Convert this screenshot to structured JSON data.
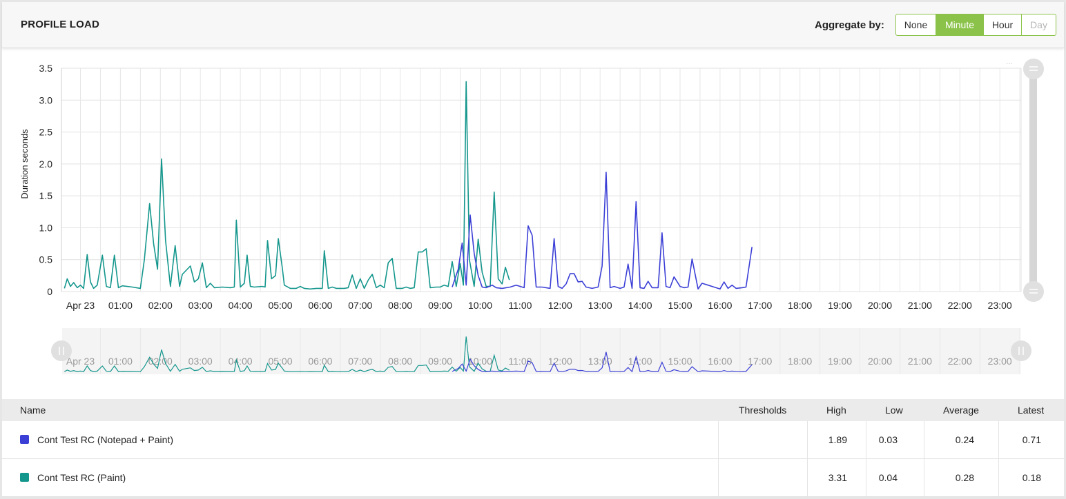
{
  "header": {
    "title": "PROFILE LOAD",
    "aggregate_label": "Aggregate by:",
    "aggregate_options": [
      "None",
      "Minute",
      "Hour",
      "Day"
    ],
    "aggregate_selected": "Minute"
  },
  "colors": {
    "blue": "#3b3fd6",
    "teal": "#13968c",
    "accent": "#8bc34a"
  },
  "chart_data": {
    "type": "line",
    "ylabel": "Duration seconds",
    "ylim": [
      0,
      3.5
    ],
    "y_ticks": [
      "0",
      "0.5",
      "1.0",
      "1.5",
      "2.0",
      "2.5",
      "3.0",
      "3.5"
    ],
    "x_ticks": [
      "Apr 23",
      "01:00",
      "02:00",
      "03:00",
      "04:00",
      "05:00",
      "06:00",
      "07:00",
      "08:00",
      "09:00",
      "10:00",
      "11:00",
      "12:00",
      "13:00",
      "14:00",
      "15:00",
      "16:00",
      "17:00",
      "18:00",
      "19:00",
      "20:00",
      "21:00",
      "22:00",
      "23:00"
    ],
    "x_unit": "hours",
    "xlim": [
      0,
      23.9
    ],
    "grid": true,
    "series": [
      {
        "name": "Cont Test RC (Paint)",
        "color": "#13968c",
        "points": [
          [
            -0.4,
            0.05
          ],
          [
            -0.33,
            0.2
          ],
          [
            -0.25,
            0.08
          ],
          [
            -0.17,
            0.14
          ],
          [
            -0.08,
            0.06
          ],
          [
            0.0,
            0.1
          ],
          [
            0.08,
            0.05
          ],
          [
            0.17,
            0.58
          ],
          [
            0.25,
            0.15
          ],
          [
            0.33,
            0.05
          ],
          [
            0.42,
            0.1
          ],
          [
            0.55,
            0.57
          ],
          [
            0.65,
            0.08
          ],
          [
            0.75,
            0.06
          ],
          [
            0.85,
            0.57
          ],
          [
            0.95,
            0.06
          ],
          [
            1.05,
            0.09
          ],
          [
            1.3,
            0.07
          ],
          [
            1.5,
            0.05
          ],
          [
            1.6,
            0.5
          ],
          [
            1.73,
            1.38
          ],
          [
            1.83,
            0.75
          ],
          [
            1.93,
            0.35
          ],
          [
            2.03,
            2.08
          ],
          [
            2.13,
            0.8
          ],
          [
            2.25,
            0.08
          ],
          [
            2.37,
            0.72
          ],
          [
            2.48,
            0.08
          ],
          [
            2.55,
            0.27
          ],
          [
            2.75,
            0.4
          ],
          [
            2.85,
            0.15
          ],
          [
            2.95,
            0.2
          ],
          [
            3.05,
            0.45
          ],
          [
            3.15,
            0.06
          ],
          [
            3.25,
            0.13
          ],
          [
            3.35,
            0.06
          ],
          [
            3.55,
            0.07
          ],
          [
            3.75,
            0.06
          ],
          [
            3.85,
            0.07
          ],
          [
            3.9,
            1.12
          ],
          [
            4.0,
            0.07
          ],
          [
            4.1,
            0.13
          ],
          [
            4.17,
            0.57
          ],
          [
            4.25,
            0.08
          ],
          [
            4.35,
            0.07
          ],
          [
            4.55,
            0.08
          ],
          [
            4.62,
            0.07
          ],
          [
            4.68,
            0.8
          ],
          [
            4.78,
            0.2
          ],
          [
            4.88,
            0.25
          ],
          [
            4.95,
            0.83
          ],
          [
            5.05,
            0.37
          ],
          [
            5.1,
            0.1
          ],
          [
            5.25,
            0.05
          ],
          [
            5.4,
            0.05
          ],
          [
            5.5,
            0.08
          ],
          [
            5.6,
            0.05
          ],
          [
            5.75,
            0.04
          ],
          [
            5.9,
            0.05
          ],
          [
            6.05,
            0.05
          ],
          [
            6.1,
            0.64
          ],
          [
            6.2,
            0.05
          ],
          [
            6.3,
            0.07
          ],
          [
            6.4,
            0.05
          ],
          [
            6.6,
            0.05
          ],
          [
            6.7,
            0.06
          ],
          [
            6.8,
            0.26
          ],
          [
            6.9,
            0.05
          ],
          [
            7.0,
            0.2
          ],
          [
            7.1,
            0.05
          ],
          [
            7.2,
            0.18
          ],
          [
            7.3,
            0.27
          ],
          [
            7.4,
            0.06
          ],
          [
            7.5,
            0.1
          ],
          [
            7.6,
            0.06
          ],
          [
            7.7,
            0.45
          ],
          [
            7.8,
            0.52
          ],
          [
            7.9,
            0.05
          ],
          [
            8.05,
            0.05
          ],
          [
            8.15,
            0.07
          ],
          [
            8.25,
            0.05
          ],
          [
            8.35,
            0.06
          ],
          [
            8.45,
            0.62
          ],
          [
            8.55,
            0.62
          ],
          [
            8.65,
            0.67
          ],
          [
            8.75,
            0.06
          ],
          [
            8.9,
            0.07
          ],
          [
            9.0,
            0.07
          ],
          [
            9.1,
            0.1
          ],
          [
            9.2,
            0.08
          ],
          [
            9.3,
            0.47
          ],
          [
            9.4,
            0.08
          ],
          [
            9.5,
            0.44
          ],
          [
            9.58,
            0.1
          ],
          [
            9.65,
            3.29
          ],
          [
            9.73,
            0.5
          ],
          [
            9.85,
            0.08
          ],
          [
            9.95,
            0.82
          ],
          [
            10.05,
            0.3
          ],
          [
            10.15,
            0.08
          ],
          [
            10.25,
            0.08
          ],
          [
            10.35,
            1.56
          ],
          [
            10.45,
            0.2
          ],
          [
            10.55,
            0.12
          ],
          [
            10.63,
            0.38
          ],
          [
            10.73,
            0.18
          ]
        ]
      },
      {
        "name": "Cont Test RC (Notepad + Paint)",
        "color": "#3b3fd6",
        "points": [
          [
            9.3,
            0.07
          ],
          [
            9.45,
            0.35
          ],
          [
            9.55,
            0.76
          ],
          [
            9.65,
            0.1
          ],
          [
            9.75,
            1.2
          ],
          [
            9.85,
            0.6
          ],
          [
            9.95,
            0.25
          ],
          [
            10.05,
            0.07
          ],
          [
            10.15,
            0.06
          ],
          [
            10.3,
            0.1
          ],
          [
            10.4,
            0.06
          ],
          [
            10.55,
            0.05
          ],
          [
            10.75,
            0.07
          ],
          [
            10.9,
            0.1
          ],
          [
            11.1,
            0.06
          ],
          [
            11.2,
            1.03
          ],
          [
            11.3,
            0.88
          ],
          [
            11.4,
            0.07
          ],
          [
            11.55,
            0.07
          ],
          [
            11.75,
            0.05
          ],
          [
            11.85,
            0.83
          ],
          [
            11.95,
            0.08
          ],
          [
            12.05,
            0.05
          ],
          [
            12.15,
            0.12
          ],
          [
            12.25,
            0.28
          ],
          [
            12.35,
            0.28
          ],
          [
            12.45,
            0.15
          ],
          [
            12.55,
            0.16
          ],
          [
            12.65,
            0.07
          ],
          [
            12.8,
            0.05
          ],
          [
            12.95,
            0.07
          ],
          [
            13.05,
            0.4
          ],
          [
            13.15,
            1.87
          ],
          [
            13.25,
            0.06
          ],
          [
            13.35,
            0.08
          ],
          [
            13.5,
            0.05
          ],
          [
            13.6,
            0.07
          ],
          [
            13.7,
            0.43
          ],
          [
            13.8,
            0.05
          ],
          [
            13.9,
            1.41
          ],
          [
            14.0,
            0.06
          ],
          [
            14.1,
            0.05
          ],
          [
            14.2,
            0.16
          ],
          [
            14.3,
            0.06
          ],
          [
            14.45,
            0.06
          ],
          [
            14.55,
            0.92
          ],
          [
            14.65,
            0.08
          ],
          [
            14.75,
            0.06
          ],
          [
            14.85,
            0.23
          ],
          [
            15.0,
            0.08
          ],
          [
            15.1,
            0.06
          ],
          [
            15.2,
            0.07
          ],
          [
            15.3,
            0.51
          ],
          [
            15.45,
            0.04
          ],
          [
            15.55,
            0.13
          ],
          [
            15.7,
            0.1
          ],
          [
            15.85,
            0.07
          ],
          [
            16.0,
            0.04
          ],
          [
            16.1,
            0.15
          ],
          [
            16.2,
            0.05
          ],
          [
            16.3,
            0.1
          ],
          [
            16.4,
            0.05
          ],
          [
            16.55,
            0.06
          ],
          [
            16.65,
            0.07
          ],
          [
            16.8,
            0.7
          ]
        ]
      }
    ]
  },
  "navigator": {
    "x_ticks": [
      "Apr 23",
      "01:00",
      "02:00",
      "03:00",
      "04:00",
      "05:00",
      "06:00",
      "07:00",
      "08:00",
      "09:00",
      "10:00",
      "11:00",
      "12:00",
      "13:00",
      "14:00",
      "15:00",
      "16:00",
      "17:00",
      "18:00",
      "19:00",
      "20:00",
      "21:00",
      "22:00",
      "23:00"
    ]
  },
  "table": {
    "headers": {
      "name": "Name",
      "thresholds": "Thresholds",
      "high": "High",
      "low": "Low",
      "average": "Average",
      "latest": "Latest"
    },
    "rows": [
      {
        "name": "Cont Test RC (Notepad + Paint)",
        "color": "#3b3fd6",
        "thresholds": "",
        "high": "1.89",
        "low": "0.03",
        "average": "0.24",
        "latest": "0.71"
      },
      {
        "name": "Cont Test RC (Paint)",
        "color": "#13968c",
        "thresholds": "",
        "high": "3.31",
        "low": "0.04",
        "average": "0.28",
        "latest": "0.18"
      }
    ]
  }
}
